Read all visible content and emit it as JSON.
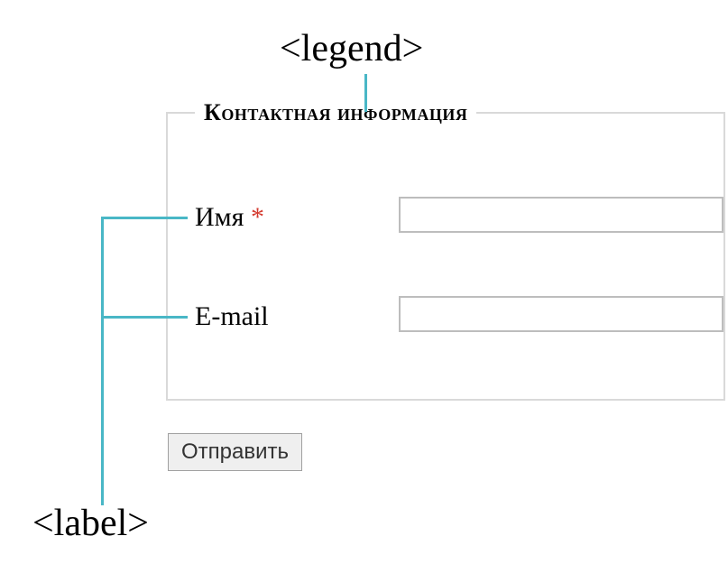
{
  "annotations": {
    "legend_tag": "<legend>",
    "label_tag": "<label>"
  },
  "form": {
    "legend": "Контактная информация",
    "fields": {
      "name": {
        "label": "Имя",
        "required_marker": "*",
        "value": ""
      },
      "email": {
        "label": "E-mail",
        "value": ""
      }
    },
    "submit_label": "Отправить"
  },
  "callout_color": "#49b7c6"
}
